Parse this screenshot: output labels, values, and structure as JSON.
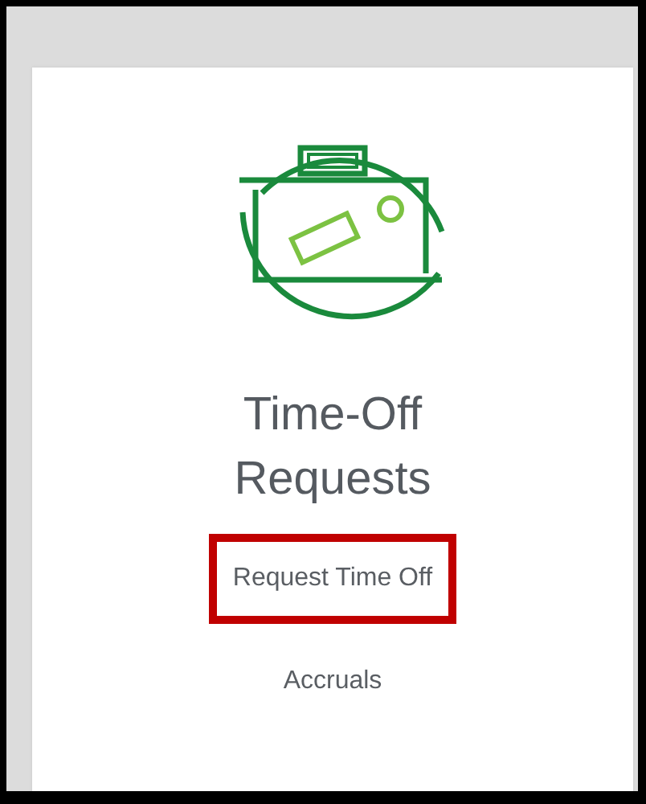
{
  "card": {
    "title": "Time-Off Requests",
    "links": [
      {
        "label": "Request Time Off",
        "highlighted": true
      },
      {
        "label": "Accruals",
        "highlighted": false
      }
    ]
  }
}
